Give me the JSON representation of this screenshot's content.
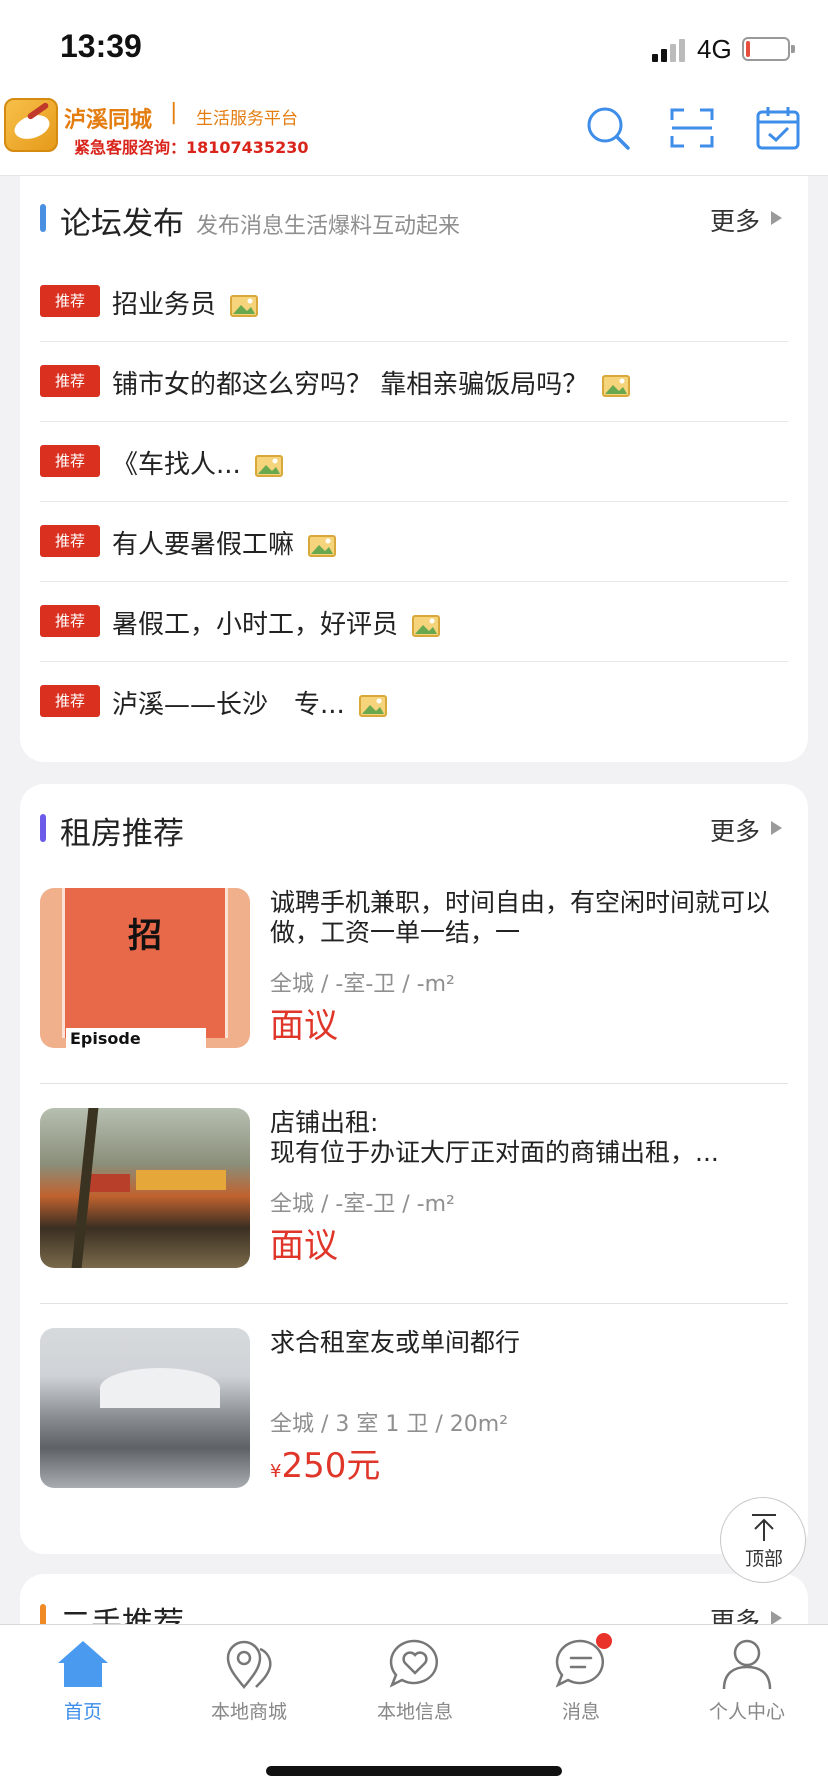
{
  "status_bar": {
    "time": "13:39",
    "network": "4G"
  },
  "header": {
    "brand_name": "泸溪同城",
    "divider": "|",
    "tagline": "生活服务平台",
    "hotline": "紧急客服咨询：18107435230"
  },
  "forum": {
    "title": "论坛发布",
    "subtitle": "发布消息生活爆料互动起来",
    "more": "更多",
    "accent_color": "#4a90e2",
    "posts": [
      {
        "tag": "推荐",
        "title": "招业务员"
      },
      {
        "tag": "推荐",
        "title": "铺市女的都这么穷吗？ 靠相亲骗饭局吗？"
      },
      {
        "tag": "推荐",
        "title": "《车找人..."
      },
      {
        "tag": "推荐",
        "title": "有人要暑假工嘛"
      },
      {
        "tag": "推荐",
        "title": "暑假工，小时工，好评员"
      },
      {
        "tag": "推荐",
        "title": "泸溪——长沙　专..."
      }
    ]
  },
  "rental": {
    "title": "租房推荐",
    "more": "更多",
    "accent_color": "#6b5be8",
    "listings": [
      {
        "title": "诚聘手机兼职，时间自由，有空闲时间就可以做，工资一单一结，一",
        "meta": "全城 / -室-卫 / -m²",
        "price": "面议",
        "thumb_char": "招",
        "thumb_caption": "Episode"
      },
      {
        "title": "店铺出租:\n现有位于办证大厅正对面的商铺出租，...",
        "meta": "全城 / -室-卫 / -m²",
        "price": "面议"
      },
      {
        "title": "求合租室友或单间都行",
        "meta": "全城 / 3 室 1 卫 / 20m²",
        "price_symbol": "¥",
        "price": "250元"
      }
    ]
  },
  "secondhand": {
    "title": "二手推荐",
    "more": "更多",
    "accent_color": "#f08a24"
  },
  "back_to_top": {
    "label": "顶部"
  },
  "tab_bar": {
    "active_color": "#3d8de9",
    "items": [
      {
        "label": "首页",
        "icon": "home-icon"
      },
      {
        "label": "本地商城",
        "icon": "map-pin-icon"
      },
      {
        "label": "本地信息",
        "icon": "heart-bubble-icon"
      },
      {
        "label": "消息",
        "icon": "chat-icon"
      },
      {
        "label": "个人中心",
        "icon": "user-icon"
      }
    ]
  }
}
